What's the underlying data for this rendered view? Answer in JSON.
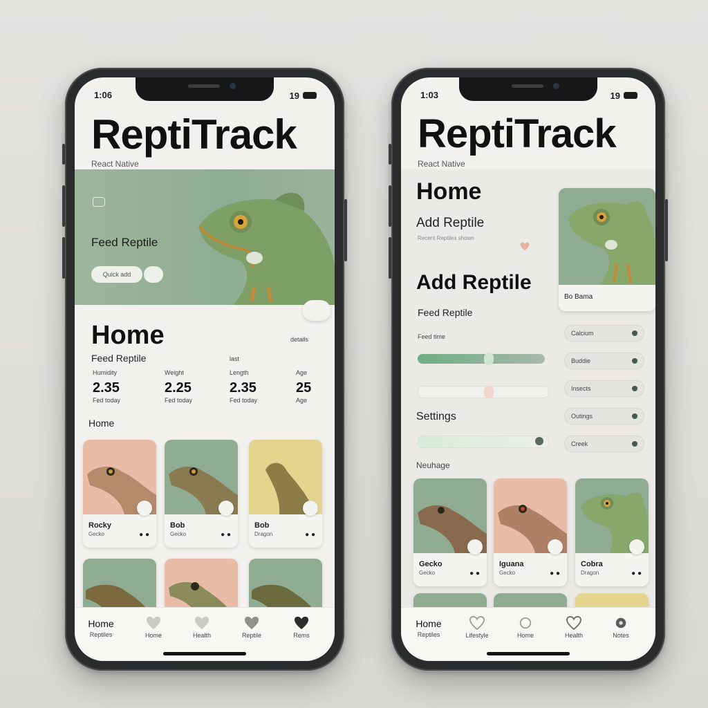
{
  "colors": {
    "accent": "#7fb290",
    "sage": "#8fac92",
    "peach": "#e9bca8",
    "sand": "#e3d48e"
  },
  "left": {
    "status_time": "1:06",
    "status_right": "19",
    "app_title": "ReptiTrack",
    "app_subtitle": "React Native",
    "hero": {
      "label": "Feed Reptile",
      "button": "Quick add"
    },
    "home_heading": "Home",
    "home_aside": "details",
    "feed_label": "Feed Reptile",
    "feed_aside": "last",
    "stats": [
      {
        "head": "Humidity",
        "value": "2.35",
        "sub": "Fed today"
      },
      {
        "head": "Weight",
        "value": "2.25",
        "sub": "Fed today"
      },
      {
        "head": "Length",
        "value": "2.35",
        "sub": "Fed today"
      },
      {
        "head": "Age",
        "value": "25",
        "sub": "Age"
      }
    ],
    "section_label": "Home",
    "cards": [
      {
        "name": "Rocky",
        "meta": "Gecko"
      },
      {
        "name": "Bob",
        "meta": "Gecko"
      },
      {
        "name": "Bob",
        "meta": "Dragon"
      }
    ],
    "tabs": [
      {
        "label": "Home",
        "sub": "Reptiles",
        "icon": "home-icon"
      },
      {
        "label": "",
        "sub": "Home",
        "icon": "heart-icon"
      },
      {
        "label": "",
        "sub": "Health",
        "icon": "heart-icon"
      },
      {
        "label": "",
        "sub": "Reptile",
        "icon": "heart-icon"
      },
      {
        "label": "",
        "sub": "Rems",
        "icon": "heart-icon"
      }
    ]
  },
  "right": {
    "status_time": "1:03",
    "status_right": "19",
    "app_title": "ReptiTrack",
    "app_subtitle": "React Native",
    "home_heading": "Home",
    "add_small": "Add Reptile",
    "add_small_sub": "Recent Reptiles shown",
    "add_big": "Add Reptile",
    "feed_label": "Feed Reptile",
    "feed_sub": "Feed time",
    "hero_caption": "Bo Bama",
    "settings_label": "Settings",
    "section_label": "Neuhage",
    "list_items": [
      "Calcium",
      "Buddie",
      "Insects",
      "Outings",
      "Creek"
    ],
    "cards": [
      {
        "name": "Gecko",
        "meta": "Gecko"
      },
      {
        "name": "Iguana",
        "meta": "Gecko"
      },
      {
        "name": "Cobra",
        "meta": "Dragon"
      }
    ],
    "tabs": [
      {
        "label": "Home",
        "sub": "Reptiles",
        "icon": "home-icon"
      },
      {
        "label": "",
        "sub": "Lifestyle",
        "icon": "heart-icon"
      },
      {
        "label": "",
        "sub": "Home",
        "icon": "circle-icon"
      },
      {
        "label": "",
        "sub": "Health",
        "icon": "heart-icon"
      },
      {
        "label": "",
        "sub": "Notes",
        "icon": "circle-icon"
      }
    ]
  }
}
